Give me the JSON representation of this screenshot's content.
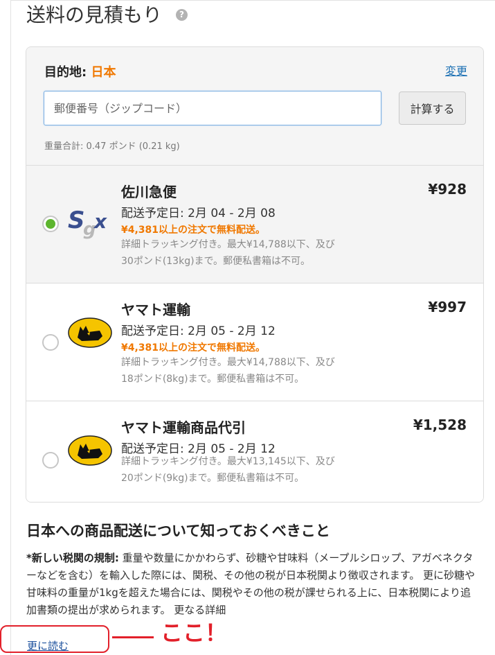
{
  "page": {
    "title": "送料の見積もり",
    "help_icon": "?"
  },
  "destination": {
    "label": "目的地:",
    "country": "日本",
    "change_link": "変更"
  },
  "zip": {
    "placeholder": "郵便番号（ジップコード）",
    "value": ""
  },
  "calculate_button": "計算する",
  "weight_total": "重量合計: 0.47 ポンド (0.21 kg)",
  "shipping_options": [
    {
      "carrier": "佐川急便",
      "price": "¥928",
      "eta": "配送予定日: 2月 04 - 2月 08",
      "free_shipping": "¥4,381以上の注文で無料配送。",
      "detail_line1": "詳細トラッキング付き。最大¥14,788以下、及び",
      "detail_line2": "30ポンド(13kg)まで。郵便私書箱は不可。",
      "logo": "sagawa-logo",
      "selected": true
    },
    {
      "carrier": "ヤマト運輸",
      "price": "¥997",
      "eta": "配送予定日: 2月 05 - 2月 12",
      "free_shipping": "¥4,381以上の注文で無料配送。",
      "detail_line1": "詳細トラッキング付き。最大¥14,788以下、及び",
      "detail_line2": "18ポンド(8kg)まで。郵便私書箱は不可。",
      "logo": "yamato-cat-logo",
      "selected": false
    },
    {
      "carrier": "ヤマト運輸商品代引",
      "price": "¥1,528",
      "eta": "配送予定日: 2月 05 - 2月 12",
      "detail_line1": "詳細トラッキング付き。最大¥13,145以下、及び",
      "detail_line2": "20ポンド(9kg)まで。郵便私書箱は不可。",
      "logo": "yamato-cat-logo",
      "selected": false
    }
  ],
  "info": {
    "title": "日本への商品配送について知っておくべきこと",
    "bold_lead": "*新しい税関の規制:",
    "body": " 重量や数量にかかわらず、砂糖や甘味料（メープルシロップ、アガベネクターなどを含む）を輸入した際には、関税、その他の税が日本税関より徴収されます。 更に砂糖や甘味料の重量が1kgを超えた場合には、関税やその他の税が課せられる上に、日本税関により追加書類の提出が求められます。 更なる詳細",
    "read_more": "更に読む"
  },
  "annotation": {
    "text": "ここ！",
    "color": "#e2202a"
  },
  "colors": {
    "accent_orange": "#f07800",
    "link_blue": "#1a6fb3",
    "radio_green": "#5db52e"
  }
}
